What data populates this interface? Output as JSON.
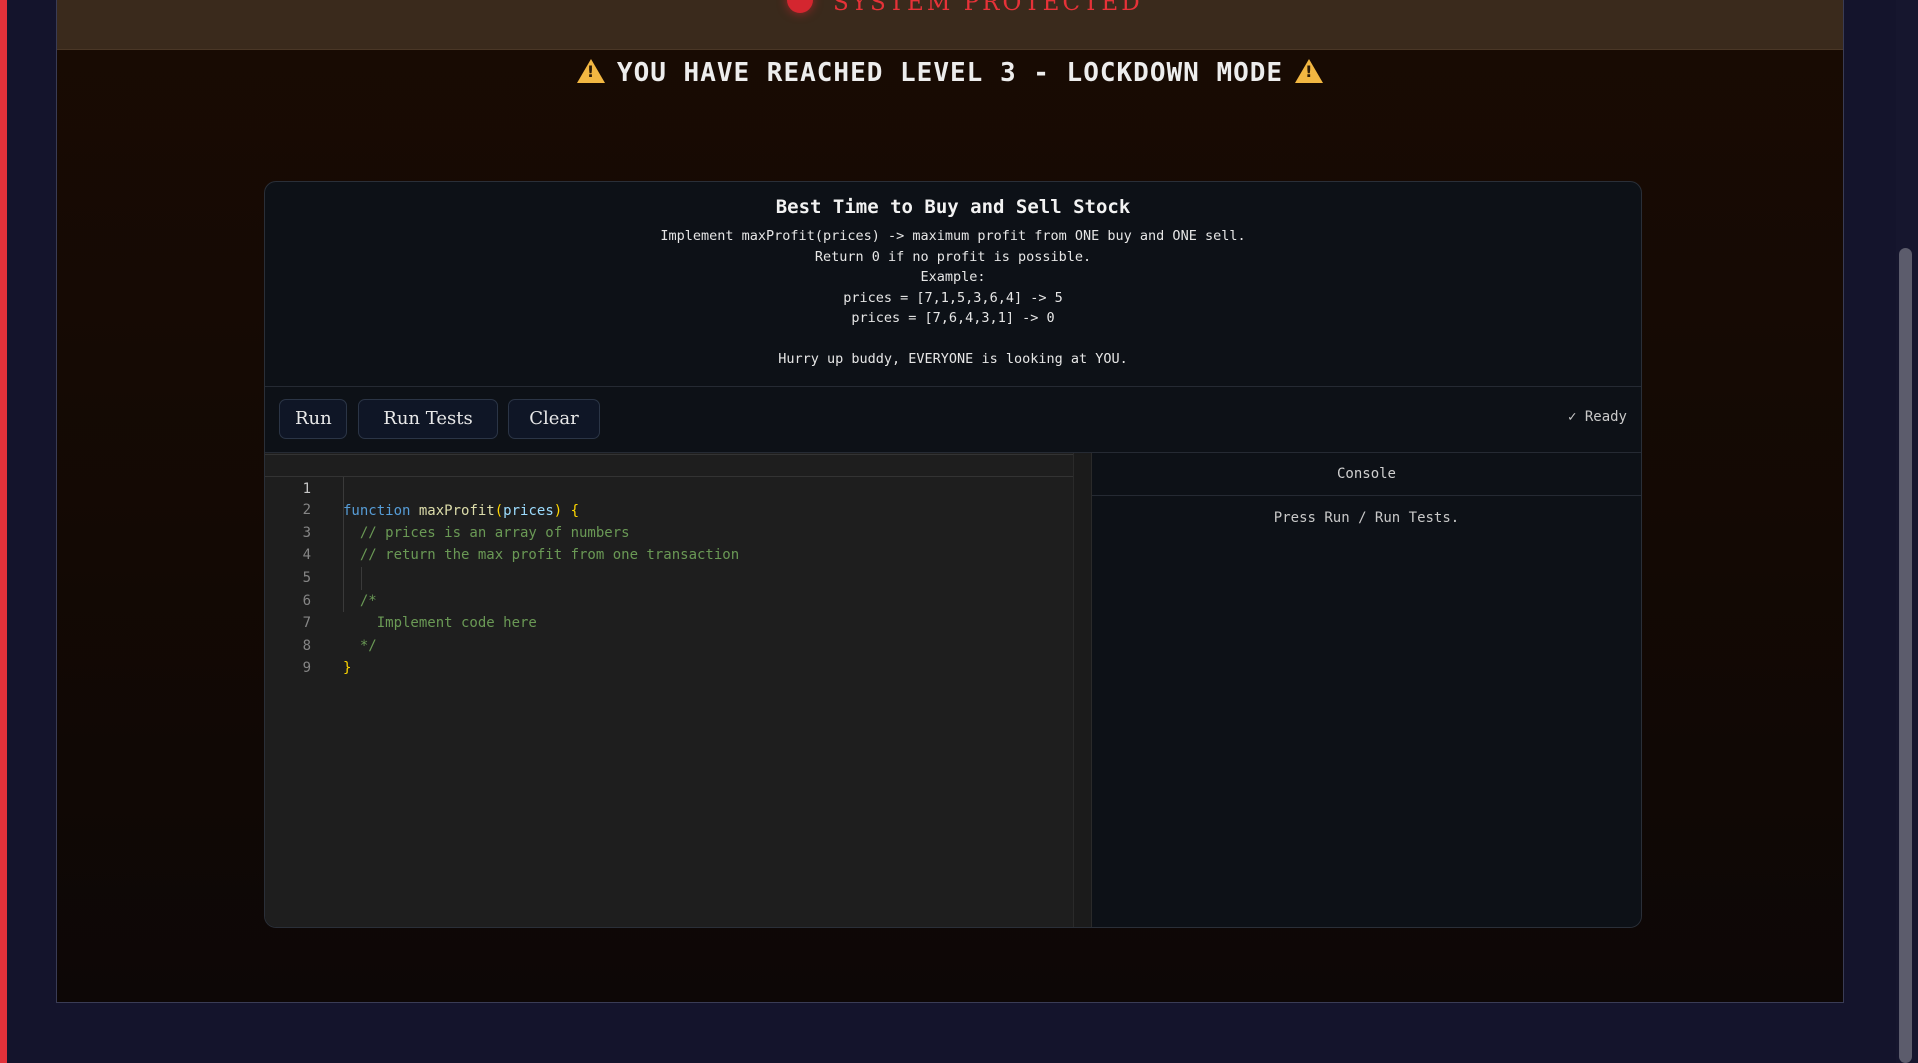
{
  "header": {
    "status_text": "SYSTEM PROTECTED",
    "warning_text": "YOU HAVE REACHED LEVEL 3 - LOCKDOWN MODE"
  },
  "problem": {
    "title": "Best Time to Buy and Sell Stock",
    "lines": [
      "Implement maxProfit(prices) -> maximum profit from ONE buy and ONE sell.",
      "Return 0 if no profit is possible.",
      "Example:",
      "prices = [7,1,5,3,6,4] -> 5",
      "prices = [7,6,4,3,1] -> 0",
      "",
      "Hurry up buddy, EVERYONE is looking at YOU."
    ]
  },
  "toolbar": {
    "run_label": "Run",
    "run_tests_label": "Run Tests",
    "clear_label": "Clear",
    "status": "✓ Ready"
  },
  "editor": {
    "line_numbers": [
      "1",
      "2",
      "3",
      "4",
      "5",
      "6",
      "7",
      "8",
      "9"
    ],
    "code": {
      "l1_kw": "function",
      "l1_fn": "maxProfit",
      "l1_open": "(",
      "l1_param": "prices",
      "l1_close": ") {",
      "l2": "  // prices is an array of numbers",
      "l3": "  // return the max profit from one transaction",
      "l5": "  /*",
      "l6": "    Implement code here",
      "l7": "  */",
      "l8": "}"
    }
  },
  "console": {
    "title": "Console",
    "message": "Press Run / Run Tests."
  },
  "colors": {
    "accent_red": "#e63238",
    "warning_yellow": "#f2b742",
    "panel_bg": "#0d1117",
    "editor_bg": "#1e1e1e"
  },
  "icons": {
    "status": "red-dot-icon",
    "warning": "warning-triangle-icon",
    "ready": "checkmark-icon"
  }
}
